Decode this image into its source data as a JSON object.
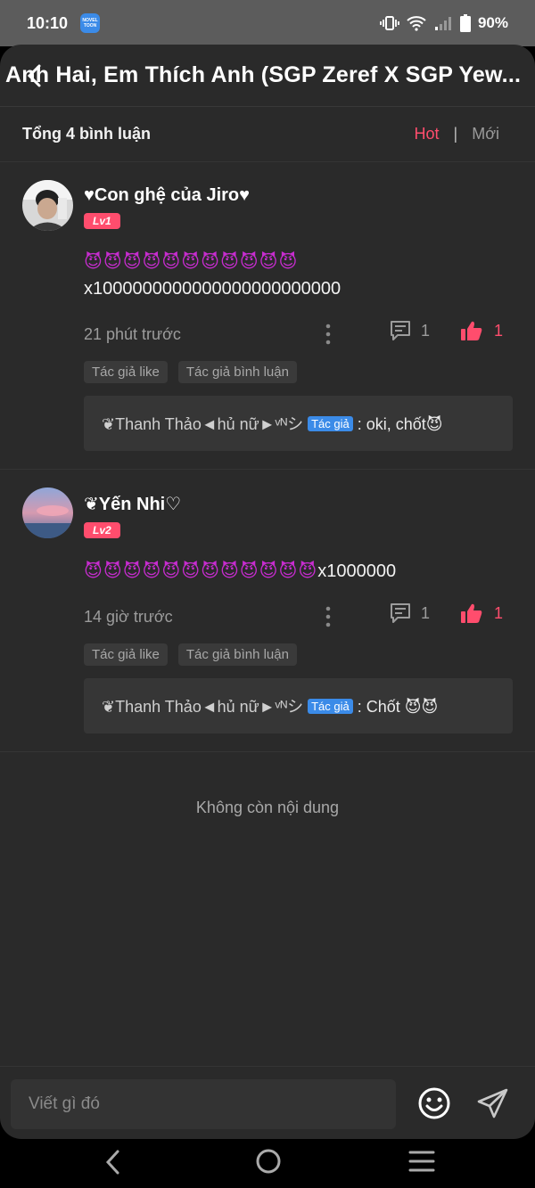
{
  "status_bar": {
    "time": "10:10",
    "app_badge": "NOVEL TOON",
    "battery": "90%"
  },
  "header": {
    "title": "Anh Hai, Em Thích Anh (SGP Zeref X SGP Yew..."
  },
  "comments_bar": {
    "count": "Tổng 4 bình luận",
    "sort_hot": "Hot",
    "sort_sep": "|",
    "sort_new": "Mới"
  },
  "comments": [
    {
      "username": "♥Con ghệ của Jiro♥",
      "level": "Lv1",
      "emojis": "😈😈😈😈😈😈😈😈😈😈😈",
      "text": "x1000000000000000000000000",
      "time": "21 phút trước",
      "reply_count": "1",
      "like_count": "1",
      "tags": [
        "Tác giả like",
        "Tác giả bình luận"
      ],
      "reply": {
        "author": "❦Thanh Thảo◄hủ nữ►ᵛᴺシ",
        "author_tag": "Tác giả",
        "text": ": oki, chốt😈"
      }
    },
    {
      "username": "❦Yến Nhi♡",
      "level": "Lv2",
      "emojis": "😈😈😈😈😈😈😈😈😈😈😈😈",
      "text": "x1000000",
      "time": "14 giờ trước",
      "reply_count": "1",
      "like_count": "1",
      "tags": [
        "Tác giả like",
        "Tác giả bình luận"
      ],
      "reply": {
        "author": "❦Thanh Thảo◄hủ nữ►ᵛᴺシ",
        "author_tag": "Tác giả",
        "text": ": Chốt 😈😈"
      }
    }
  ],
  "end_text": "Không còn nội dung",
  "input": {
    "placeholder": "Viết gì đó"
  },
  "colors": {
    "accent": "#ff4d6d",
    "author_tag": "#3b8be8",
    "background": "#2a2a2a"
  }
}
